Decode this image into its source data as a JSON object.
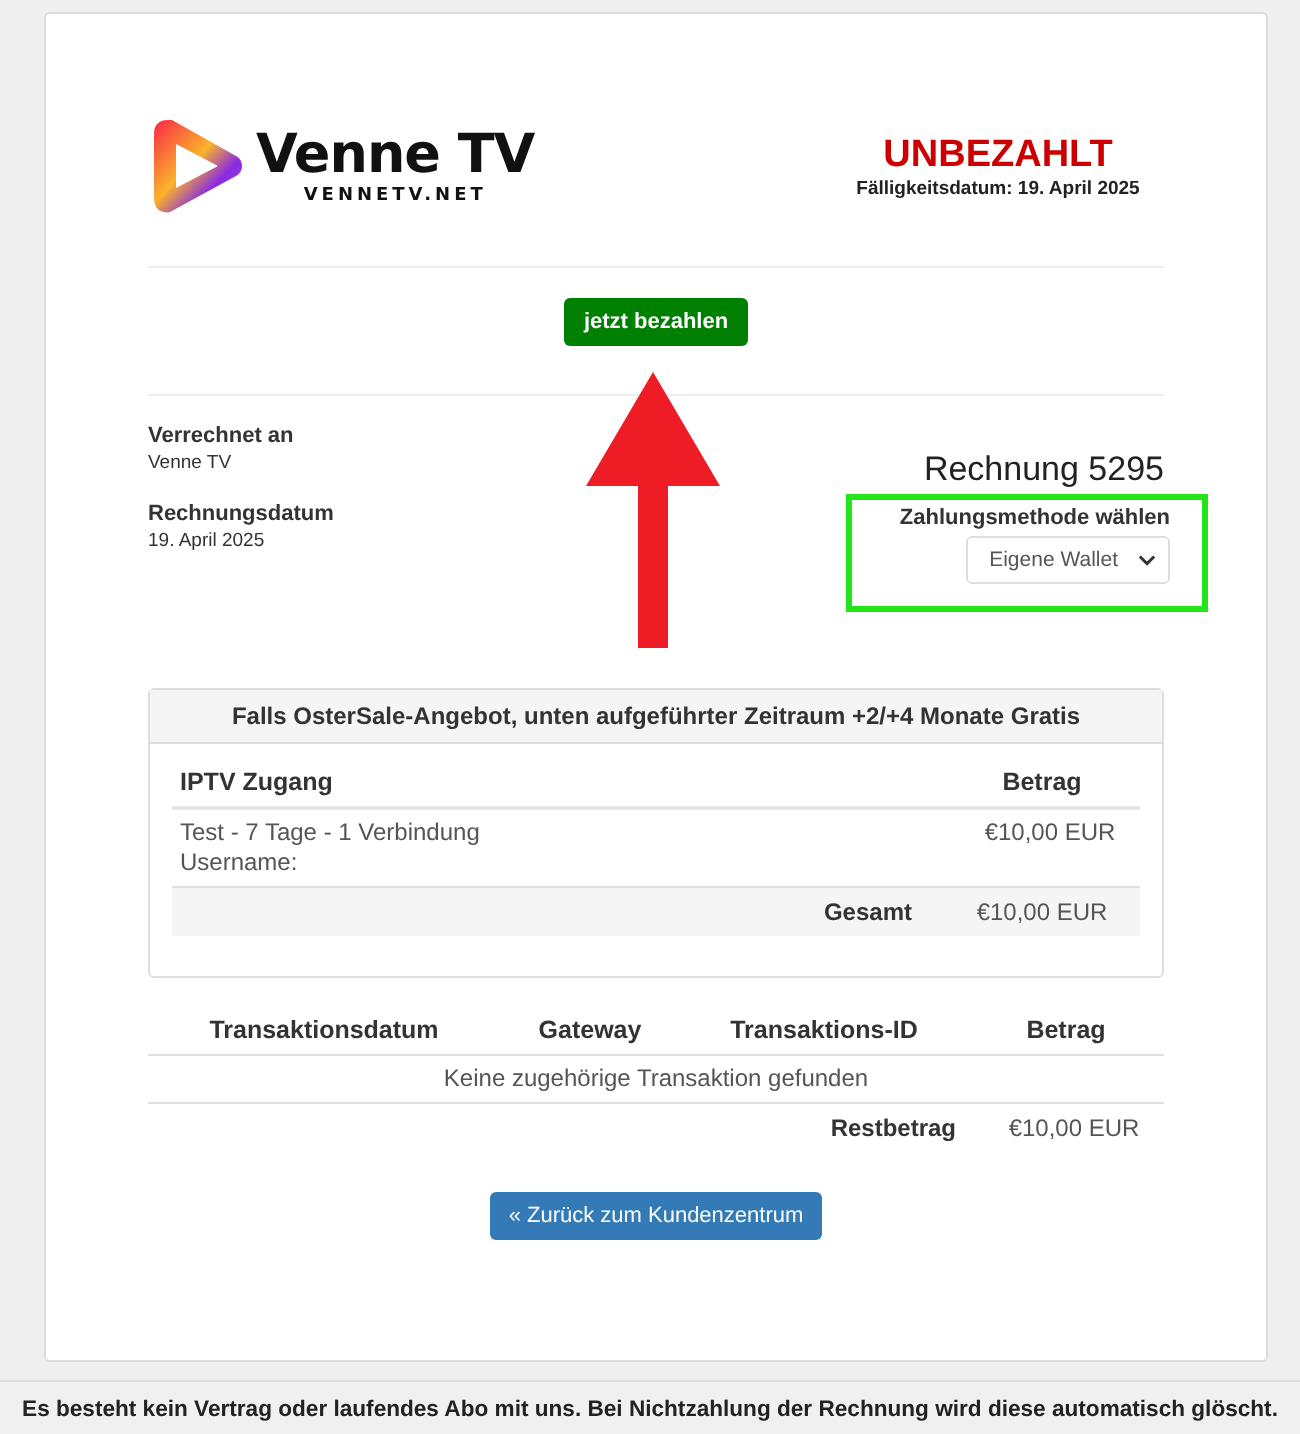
{
  "logo": {
    "name": "Venne TV",
    "domain": "VENNETV.NET"
  },
  "status": {
    "label": "UNBEZAHLT",
    "due_date": "Fälligkeitsdatum: 19. April 2025"
  },
  "pay_button": "jetzt bezahlen",
  "billed_to": {
    "label": "Verrechnet an",
    "value": "Venne TV"
  },
  "invoice_date": {
    "label": "Rechnungsdatum",
    "value": "19. April 2025"
  },
  "invoice_title": "Rechnung 5295",
  "payment_method": {
    "label": "Zahlungsmethode wählen",
    "value": "Eigene Wallet"
  },
  "items_panel": {
    "title": "Falls OsterSale-Angebot, unten aufgeführter Zeitraum +2/+4 Monate Gratis",
    "columns": [
      "IPTV Zugang",
      "Betrag"
    ],
    "rows": [
      {
        "description": "Test - 7 Tage - 1 Verbindung",
        "detail": "Username:",
        "amount": "€10,00 EUR"
      }
    ],
    "total": {
      "label": "Gesamt",
      "amount": "€10,00 EUR"
    }
  },
  "transactions": {
    "columns": [
      "Transaktionsdatum",
      "Gateway",
      "Transaktions-ID",
      "Betrag"
    ],
    "empty_message": "Keine zugehörige Transaktion gefunden",
    "balance": {
      "label": "Restbetrag",
      "amount": "€10,00 EUR"
    }
  },
  "back_button": "« Zurück zum Kundenzentrum",
  "notice": "Es besteht kein Vertrag oder laufendes Abo mit uns. Bei Nichtzahlung der Rechnung wird diese automatisch glöscht."
}
